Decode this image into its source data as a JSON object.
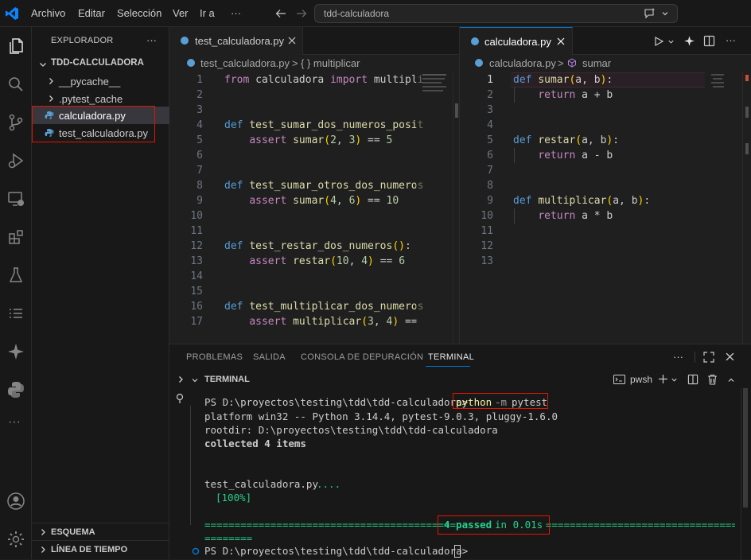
{
  "menu": {
    "archivo": "Archivo",
    "editar": "Editar",
    "seleccion": "Selección",
    "ver": "Ver",
    "ir": "Ir a",
    "more": "···"
  },
  "search": {
    "value": "tdd-calculadora"
  },
  "sidebar": {
    "header": "EXPLORADOR",
    "more": "···",
    "root": "TDD-CALCULADORA",
    "items": [
      {
        "label": "__pycache__"
      },
      {
        "label": ".pytest_cache"
      },
      {
        "label": "calculadora.py"
      },
      {
        "label": "test_calculadora.py"
      }
    ],
    "outline": "ESQUEMA",
    "timeline": "LÍNEA DE TIEMPO"
  },
  "left_editor": {
    "tab": "test_calculadora.py",
    "crumb_file": "test_calculadora.py",
    "crumb_sep": ">",
    "crumb_symbol": "{ } multiplicar",
    "line_numbers": [
      "1",
      "2",
      "3",
      "4",
      "5",
      "6",
      "7",
      "8",
      "9",
      "10",
      "11",
      "12",
      "13",
      "14",
      "15",
      "16",
      "17"
    ]
  },
  "right_editor": {
    "tab": "calculadora.py",
    "crumb_file": "calculadora.py",
    "crumb_sep": ">",
    "crumb_symbol": "sumar",
    "line_numbers": [
      "1",
      "2",
      "3",
      "4",
      "5",
      "6",
      "7",
      "8",
      "9",
      "10",
      "11",
      "12",
      "13"
    ]
  },
  "panel": {
    "tabs": [
      "PROBLEMAS",
      "SALIDA",
      "CONSOLA DE DEPURACIÓN",
      "TERMINAL"
    ],
    "section": "TERMINAL",
    "shell": "pwsh",
    "more": "···",
    "prompt": "PS D:\\proyectos\\testing\\tdd\\tdd-calculadora>",
    "cmd_python": "python",
    "cmd_flag": "-m",
    "cmd_module": "pytest",
    "platform": "platform win32 -- Python 3.14.4, pytest-9.0.3, pluggy-1.6.0",
    "rootdir": "rootdir: D:\\proyectos\\testing\\tdd\\tdd-calculadora",
    "collected": "collected 4 items",
    "test_file": "test_calculadora.py",
    "dots": "....",
    "percent": "[100%]",
    "sep_left": "==========================================",
    "passed": "4 passed",
    "time": "in 0.01s",
    "sep_right": "==================================",
    "sep_wrap": "========",
    "prompt2": "PS D:\\proyectos\\testing\\tdd\\tdd-calculadora>"
  },
  "colors": {
    "accent": "#0078d4",
    "highlight": "#e51400",
    "pass": "#23d18b"
  }
}
